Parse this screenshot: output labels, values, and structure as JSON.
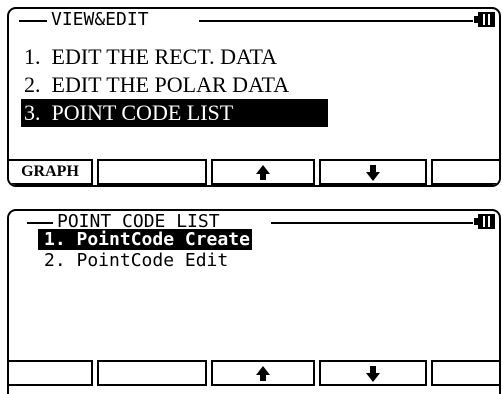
{
  "screen1": {
    "title": "VIEW&EDIT",
    "battery_icon": "battery-icon",
    "menu": [
      {
        "label": "1.  EDIT THE RECT. DATA",
        "selected": false
      },
      {
        "label": "2.  EDIT THE POLAR DATA",
        "selected": false
      },
      {
        "label": "3.  POINT CODE LIST",
        "selected": true
      }
    ],
    "softkeys": [
      {
        "label": "GRAPH"
      },
      {
        "label": ""
      },
      {
        "icon": "up-arrow-icon"
      },
      {
        "icon": "down-arrow-icon"
      },
      {
        "label": ""
      }
    ]
  },
  "screen2": {
    "title": "POINT CODE LIST",
    "battery_icon": "battery-icon",
    "menu": [
      {
        "label": "1. PointCode Create",
        "selected": true
      },
      {
        "label": "2. PointCode Edit",
        "selected": false
      }
    ],
    "softkeys": [
      {
        "label": ""
      },
      {
        "label": ""
      },
      {
        "icon": "up-arrow-icon"
      },
      {
        "icon": "down-arrow-icon"
      },
      {
        "label": ""
      }
    ]
  }
}
